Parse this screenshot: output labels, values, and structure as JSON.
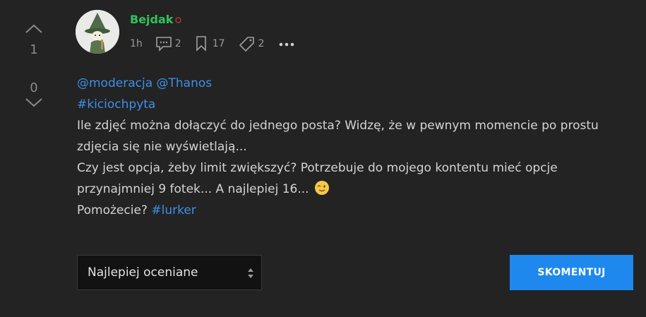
{
  "votes": {
    "up_count": "1",
    "down_count": "0"
  },
  "post": {
    "author": "Bejdak",
    "time": "1h",
    "comments_count": "2",
    "favorites_count": "17",
    "tags_count": "2",
    "mentions": [
      "@moderacja",
      "@Thanos"
    ],
    "hashtag": "#kiciochpyta",
    "body": {
      "line1": "Ile zdjęć można dołączyć do jednego posta? Widzę, że w pewnym momencie po prostu",
      "line2": "zdjęcia się nie wyświetlają...",
      "line3": "Czy jest opcja, żeby limit zwiększyć? Potrzebuje do mojego kontentu mieć opcje",
      "line4": "przynajmniej 9 fotek... A najlepiej 16...",
      "line5": "Pomożecie?",
      "line5_tag": "#lurker"
    }
  },
  "sort": {
    "selected": "Najlepiej oceniane"
  },
  "comment_button": "SKOMENTUJ",
  "colors": {
    "background": "#232323",
    "username": "#2ec45d",
    "link": "#3e8fe8",
    "button": "#1e88ef"
  }
}
